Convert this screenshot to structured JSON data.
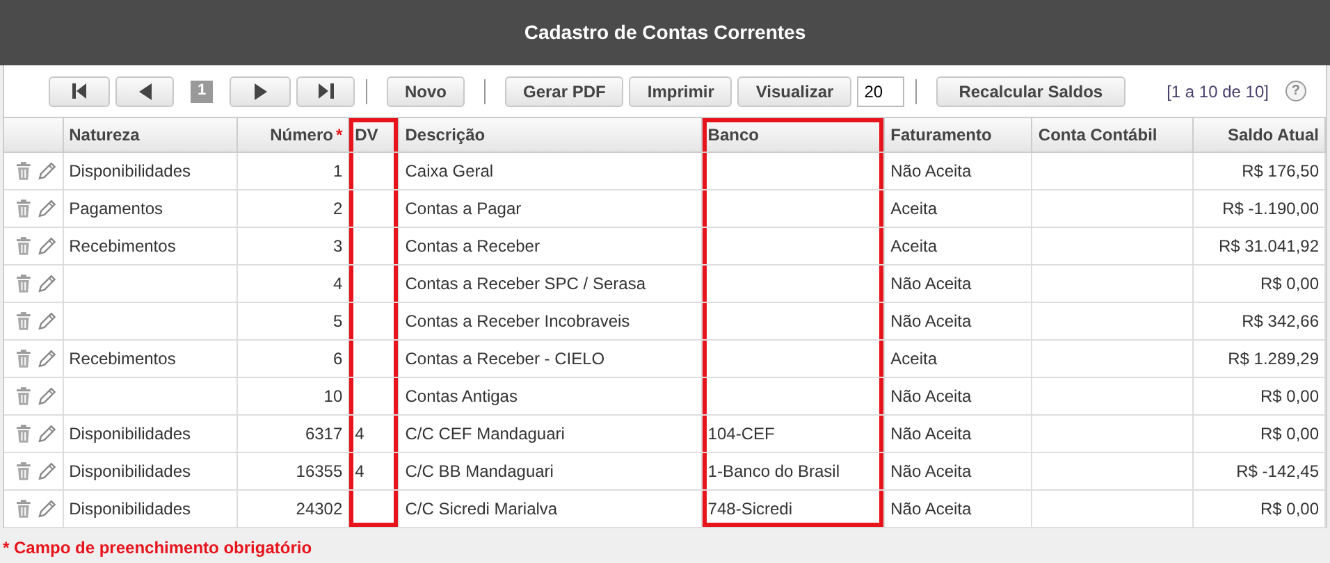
{
  "window": {
    "title": "Cadastro de Contas Correntes"
  },
  "toolbar": {
    "page": "1",
    "buttons": [
      "Novo"
    ],
    "report_buttons": [
      "Gerar PDF",
      "Imprimir",
      "Visualizar"
    ],
    "page_size": "20",
    "recalc_button": "Recalcular Saldos",
    "range": "[1 a 10 de 10]",
    "help": "?"
  },
  "table": {
    "columns": [
      {
        "label": "Natureza",
        "kind": "text",
        "highlighted": false
      },
      {
        "label": "Número",
        "required_mark": "*",
        "kind": "number",
        "highlighted": false
      },
      {
        "label": "DV",
        "kind": "text",
        "highlighted": true
      },
      {
        "label": "Descrição",
        "kind": "text",
        "highlighted": false
      },
      {
        "label": "Banco",
        "kind": "text",
        "highlighted": true
      },
      {
        "label": "Faturamento",
        "kind": "text",
        "highlighted": false
      },
      {
        "label": "Conta Contábil",
        "kind": "text",
        "highlighted": false
      },
      {
        "label": "Saldo Atual",
        "kind": "number",
        "highlighted": false
      }
    ],
    "rows": [
      [
        "Disponibilidades",
        "1",
        "",
        "Caixa Geral",
        "",
        "Não Aceita",
        "",
        "R$ 176,50"
      ],
      [
        "Pagamentos",
        "2",
        "",
        "Contas a Pagar",
        "",
        "Aceita",
        "",
        "R$ -1.190,00"
      ],
      [
        "Recebimentos",
        "3",
        "",
        "Contas a Receber",
        "",
        "Aceita",
        "",
        "R$ 31.041,92"
      ],
      [
        "",
        "4",
        "",
        "Contas a Receber SPC / Serasa",
        "",
        "Não Aceita",
        "",
        "R$ 0,00"
      ],
      [
        "",
        "5",
        "",
        "Contas a Receber Incobraveis",
        "",
        "Não Aceita",
        "",
        "R$ 342,66"
      ],
      [
        "Recebimentos",
        "6",
        "",
        "Contas a Receber - CIELO",
        "",
        "Aceita",
        "",
        "R$ 1.289,29"
      ],
      [
        "",
        "10",
        "",
        "Contas Antigas",
        "",
        "Não Aceita",
        "",
        "R$ 0,00"
      ],
      [
        "Disponibilidades",
        "6317",
        "4",
        "C/C CEF Mandaguari",
        "104-CEF",
        "Não Aceita",
        "",
        "R$ 0,00"
      ],
      [
        "Disponibilidades",
        "16355",
        "4",
        "C/C BB Mandaguari",
        "1-Banco do Brasil",
        "Não Aceita",
        "",
        "R$ -142,45"
      ],
      [
        "Disponibilidades",
        "24302",
        "",
        "C/C Sicredi Marialva",
        "748-Sicredi",
        "Não Aceita",
        "",
        "R$ 0,00"
      ]
    ]
  },
  "footnote": "* Campo de preenchimento obrigatório"
}
